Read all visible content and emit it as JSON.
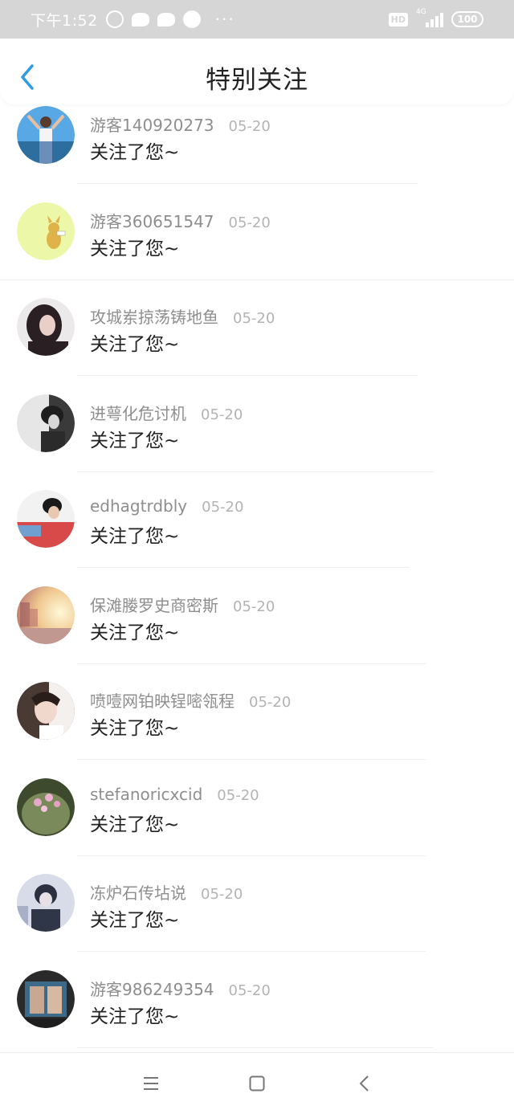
{
  "status_bar": {
    "time": "下午1:52",
    "hd": "HD",
    "network": "4G",
    "battery": "100",
    "more": "···"
  },
  "header": {
    "title": "特别关注"
  },
  "list": [
    {
      "name": "游客140920273",
      "date": "05-20",
      "message": "关注了您~"
    },
    {
      "name": "游客360651547",
      "date": "05-20",
      "message": "关注了您~"
    },
    {
      "name": "攻城岽掠荡铸地鱼",
      "date": "05-20",
      "message": "关注了您~"
    },
    {
      "name": "进萼化危讨机",
      "date": "05-20",
      "message": "关注了您~"
    },
    {
      "name": "edhagtrdbly",
      "date": "05-20",
      "message": "关注了您~"
    },
    {
      "name": "保滩媵罗史商密斯",
      "date": "05-20",
      "message": "关注了您~"
    },
    {
      "name": "喷噎网铂映锃嘧瓴程",
      "date": "05-20",
      "message": "关注了您~"
    },
    {
      "name": "stefanoricxcid",
      "date": "05-20",
      "message": "关注了您~"
    },
    {
      "name": "冻炉石传坫说",
      "date": "05-20",
      "message": "关注了您~"
    },
    {
      "name": "游客986249354",
      "date": "05-20",
      "message": "关注了您~"
    }
  ],
  "colors": {
    "accent": "#2f9be6",
    "status_bar_bg": "#d6d6d6"
  }
}
